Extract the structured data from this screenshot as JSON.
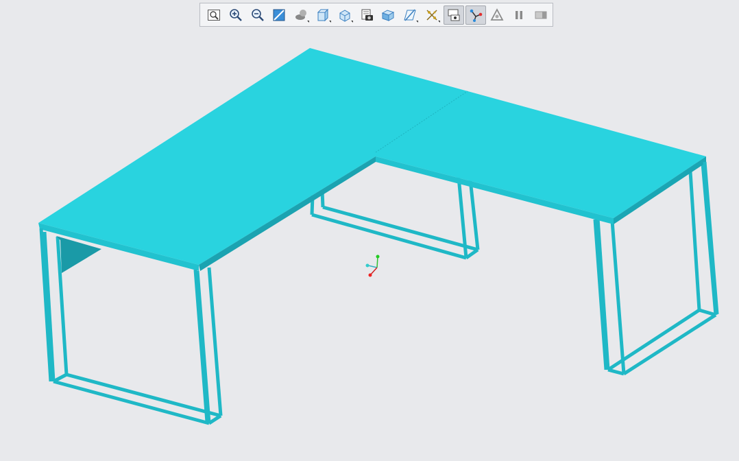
{
  "app": {
    "viewport_background": "#e8e9ec",
    "model_color": "#29d3df",
    "model_shadow_color": "#1a9aa7"
  },
  "toolbar": {
    "buttons": [
      {
        "name": "refit-button",
        "icon": "zoom-fit-icon",
        "active": false
      },
      {
        "name": "zoom-in-button",
        "icon": "zoom-in-icon",
        "active": false
      },
      {
        "name": "zoom-out-button",
        "icon": "zoom-out-icon",
        "active": false
      },
      {
        "name": "repaint-button",
        "icon": "repaint-icon",
        "active": false
      },
      {
        "name": "perspective-button",
        "icon": "perspective-icon",
        "active": false,
        "dropdown": true
      },
      {
        "name": "display-style-button",
        "icon": "display-style-icon",
        "active": false,
        "dropdown": true
      },
      {
        "name": "saved-views-button",
        "icon": "saved-orientations-icon",
        "active": false,
        "dropdown": true
      },
      {
        "name": "view-manager-button",
        "icon": "view-manager-icon",
        "active": false
      },
      {
        "name": "section-button",
        "icon": "section-icon",
        "active": false
      },
      {
        "name": "datum-display-button",
        "icon": "datum-display-icon",
        "active": false,
        "dropdown": true
      },
      {
        "name": "annotation-display-button",
        "icon": "annotation-display-icon",
        "active": false,
        "dropdown": true
      },
      {
        "name": "spin-center-button",
        "icon": "spin-center-icon",
        "active": true
      },
      {
        "name": "coordinate-triad-button",
        "icon": "coordinate-triad-icon",
        "active": true
      },
      {
        "name": "appearance-button",
        "icon": "appearance-icon",
        "active": false
      },
      {
        "name": "pause-button",
        "icon": "pause-icon",
        "active": false
      },
      {
        "name": "next-button",
        "icon": "next-icon",
        "active": false
      }
    ]
  }
}
